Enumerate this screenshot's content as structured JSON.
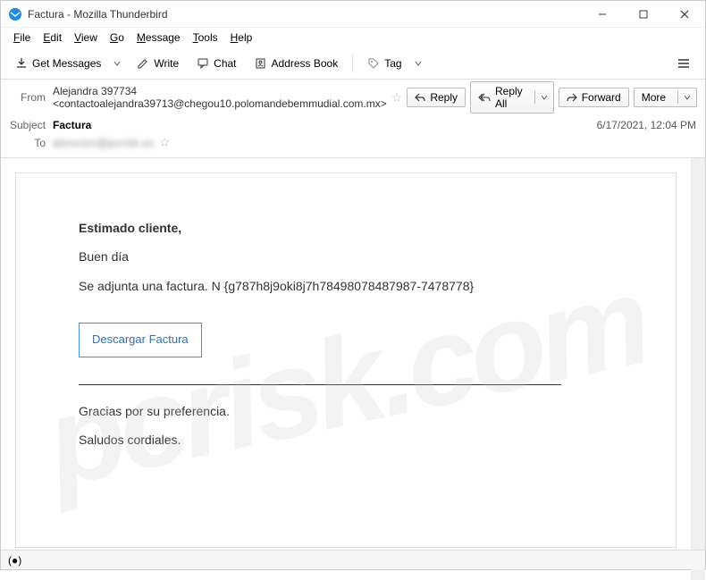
{
  "window": {
    "title": "Factura - Mozilla Thunderbird"
  },
  "menubar": {
    "items": [
      {
        "label": "File",
        "underline": "F"
      },
      {
        "label": "Edit",
        "underline": "E"
      },
      {
        "label": "View",
        "underline": "V"
      },
      {
        "label": "Go",
        "underline": "G"
      },
      {
        "label": "Message",
        "underline": "M"
      },
      {
        "label": "Tools",
        "underline": "T"
      },
      {
        "label": "Help",
        "underline": "H"
      }
    ]
  },
  "toolbar": {
    "get_messages": "Get Messages",
    "write": "Write",
    "chat": "Chat",
    "address_book": "Address Book",
    "tag": "Tag"
  },
  "actions": {
    "reply": "Reply",
    "reply_all": "Reply All",
    "forward": "Forward",
    "more": "More"
  },
  "headers": {
    "from_label": "From",
    "from_value": "Alejandra 397734 <contactoalejandra39713@chegou10.polomandebemmudial.com.mx>",
    "subject_label": "Subject",
    "subject_value": "Factura",
    "to_label": "To",
    "to_value": "atencion@pcrisk.es",
    "date": "6/17/2021, 12:04 PM"
  },
  "message": {
    "greeting": "Estimado cliente,",
    "line1": "Buen día",
    "line2": "Se adjunta una factura. N {g787h8j9oki8j7h78498078487987-7478778}",
    "download": "Descargar Factura",
    "thanks": "Gracias por su preferencia.",
    "signoff": "Saludos cordiales."
  },
  "watermark": "pcrisk.com"
}
